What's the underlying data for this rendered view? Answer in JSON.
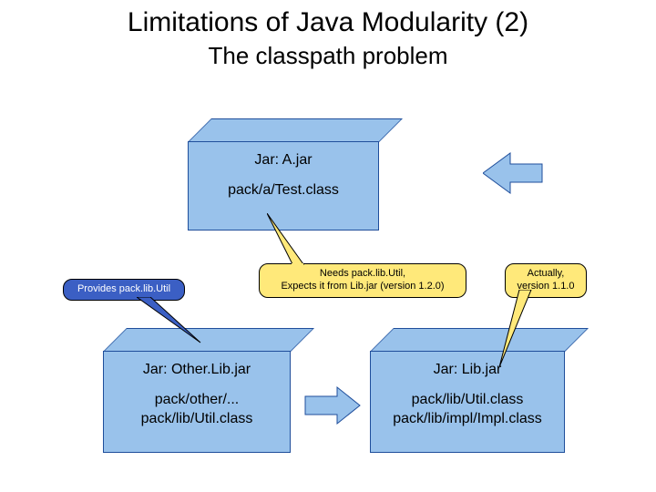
{
  "title": "Limitations of Java Modularity (2)",
  "subtitle": "The classpath problem",
  "boxes": {
    "a": {
      "title": "Jar: A.jar",
      "content": "pack/a/Test.class"
    },
    "other": {
      "title": "Jar: Other.Lib.jar",
      "content": "pack/other/...\npack/lib/Util.class"
    },
    "lib": {
      "title": "Jar: Lib.jar",
      "content": "pack/lib/Util.class\npack/lib/impl/Impl.class"
    }
  },
  "callouts": {
    "provides": "Provides pack.lib.Util",
    "needs": "Needs pack.lib.Util,\nExpects it from Lib.jar (version 1.2.0)",
    "actually": "Actually,\nversion 1.1.0"
  }
}
